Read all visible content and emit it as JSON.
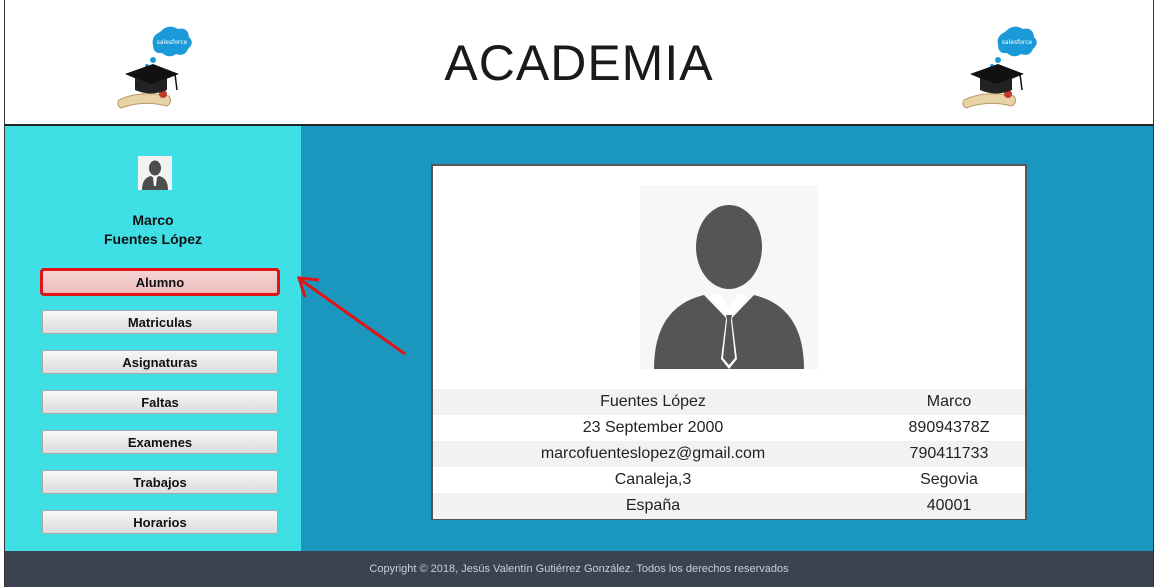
{
  "header": {
    "title": "ACADEMIA",
    "logo_text": "salesforce"
  },
  "sidebar": {
    "user_first_name": "Marco",
    "user_last_name": "Fuentes López",
    "nav": [
      {
        "label": "Alumno",
        "active": true
      },
      {
        "label": "Matriculas",
        "active": false
      },
      {
        "label": "Asignaturas",
        "active": false
      },
      {
        "label": "Faltas",
        "active": false
      },
      {
        "label": "Examenes",
        "active": false
      },
      {
        "label": "Trabajos",
        "active": false
      },
      {
        "label": "Horarios",
        "active": false
      }
    ]
  },
  "profile": {
    "rows": [
      [
        "Fuentes López",
        "Marco"
      ],
      [
        "23 September 2000",
        "89094378Z"
      ],
      [
        "marcofuenteslopez@gmail.com",
        "790411733"
      ],
      [
        "Canaleja,3",
        "Segovia"
      ],
      [
        "España",
        "40001"
      ]
    ]
  },
  "footer": {
    "copyright": "Copyright © 2018, Jesús Valentín Gutiérrez González. Todos los derechos reservados"
  },
  "colors": {
    "sidebar_bg": "#3ee0e6",
    "main_bg": "#1b96bf",
    "footer_bg": "#3b4252",
    "highlight": "#e01414"
  }
}
